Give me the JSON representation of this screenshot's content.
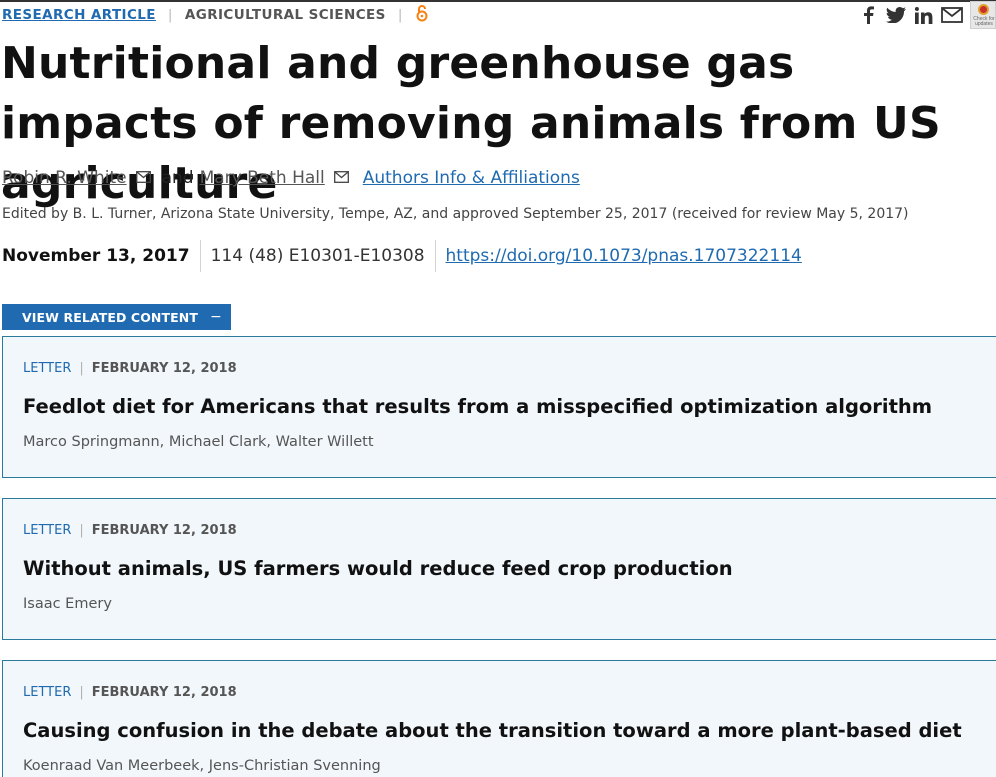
{
  "header": {
    "article_type": "RESEARCH ARTICLE",
    "separator": "|",
    "subject": "AGRICULTURAL SCIENCES",
    "open_access_icon": "open-access-icon"
  },
  "share": {
    "icons": [
      "facebook-icon",
      "twitter-icon",
      "linkedin-icon",
      "email-icon"
    ],
    "badge_text": "Check for updates"
  },
  "article": {
    "title": "Nutritional and greenhouse gas impacts of removing animals from US agriculture",
    "authors": [
      {
        "name": "Robin R. White"
      },
      {
        "name": "Mary Beth Hall"
      }
    ],
    "and_text": "and",
    "affiliations_link": "Authors Info & Affiliations",
    "edited_by": "Edited by B. L. Turner, Arizona State University, Tempe, AZ, and approved September 25, 2017 (received for review May 5, 2017)",
    "pub_date": "November 13, 2017",
    "citation": "114 (48) E10301-E10308",
    "doi": "https://doi.org/10.1073/pnas.1707322114"
  },
  "related": {
    "button_label": "VIEW RELATED CONTENT",
    "button_symbol": "−",
    "items": [
      {
        "type": "LETTER",
        "date": "FEBRUARY 12, 2018",
        "title": "Feedlot diet for Americans that results from a misspecified optimization algorithm",
        "authors": "Marco Springmann, Michael Clark, Walter Willett"
      },
      {
        "type": "LETTER",
        "date": "FEBRUARY 12, 2018",
        "title": "Without animals, US farmers would reduce feed crop production",
        "authors": "Isaac Emery"
      },
      {
        "type": "LETTER",
        "date": "FEBRUARY 12, 2018",
        "title": "Causing confusion in the debate about the transition toward a more plant-based diet",
        "authors": "Koenraad Van Meerbeek, Jens-Christian Svenning"
      }
    ]
  },
  "colors": {
    "link": "#1f6ab0",
    "open_access": "#f68212",
    "card_background": "#f2f7fb",
    "card_border": "#2a7a9b"
  }
}
